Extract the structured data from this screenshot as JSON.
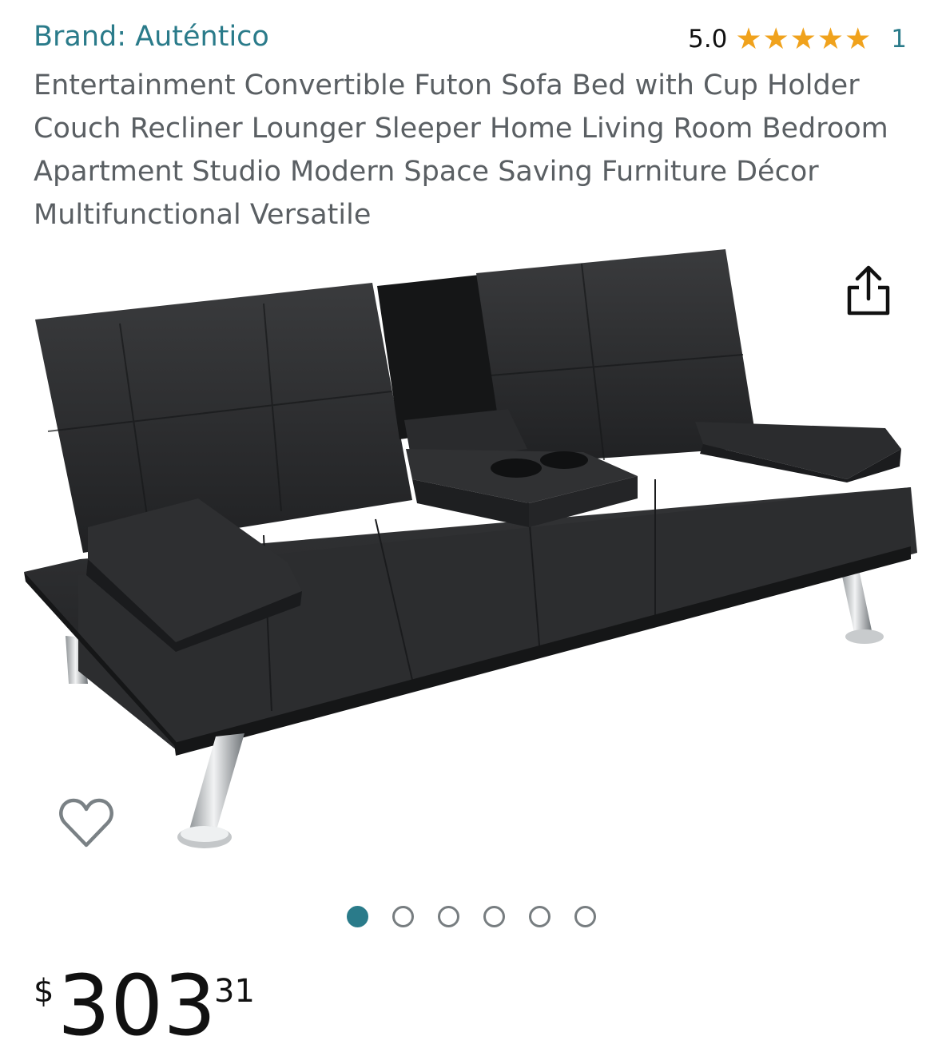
{
  "product": {
    "brand_label": "Brand: Auténtico",
    "rating_value": "5.0",
    "rating_stars": 5,
    "rating_count": "1",
    "title": "Entertainment Convertible Futon Sofa Bed with Cup Holder Couch Recliner Lounger Sleeper Home Living Room Bedroom Apartment Studio Modern Space Saving Furniture Décor Multifunctional Versatile"
  },
  "gallery": {
    "image_count": 6,
    "active_index": 0,
    "share_icon": "share-icon",
    "wishlist_icon": "heart-icon"
  },
  "price": {
    "symbol": "$",
    "whole": "303",
    "fraction": "31"
  },
  "colors": {
    "accent": "#2a7b8a",
    "star": "#f0a21c",
    "text": "#111111",
    "title": "#5a5f63"
  }
}
